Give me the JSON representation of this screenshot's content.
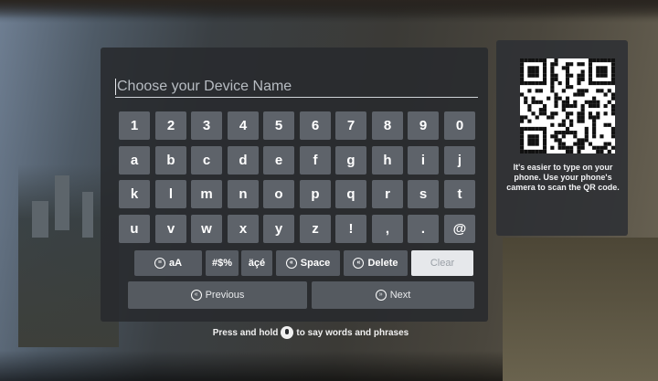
{
  "input": {
    "placeholder": "Choose your Device Name"
  },
  "keyboard": {
    "rows": [
      [
        "1",
        "2",
        "3",
        "4",
        "5",
        "6",
        "7",
        "8",
        "9",
        "0"
      ],
      [
        "a",
        "b",
        "c",
        "d",
        "e",
        "f",
        "g",
        "h",
        "i",
        "j"
      ],
      [
        "k",
        "l",
        "m",
        "n",
        "o",
        "p",
        "q",
        "r",
        "s",
        "t"
      ],
      [
        "u",
        "v",
        "w",
        "x",
        "y",
        "z",
        "!",
        ",",
        ".",
        "@"
      ]
    ],
    "functions": {
      "case_label": "aA",
      "case_icon": "menu-icon",
      "symbols_label": "#$%",
      "accents_label": "äçé",
      "space_label": "Space",
      "space_icon": "rewind-icon",
      "delete_label": "Delete",
      "delete_icon": "rewind-icon",
      "clear_label": "Clear"
    },
    "previous_label": "Previous",
    "previous_icon": "rewind-icon",
    "next_label": "Next",
    "next_icon": "fast-forward-icon"
  },
  "qr": {
    "text": "It's easier to type on your phone. Use your phone's camera to scan the QR code."
  },
  "hint": {
    "before": "Press and hold",
    "icon": "microphone-icon",
    "after": "to say words and phrases"
  },
  "colors": {
    "key_bg": "#5e636a",
    "clear_bg": "#e6e8eb",
    "panel_bg": "#282a2e"
  }
}
